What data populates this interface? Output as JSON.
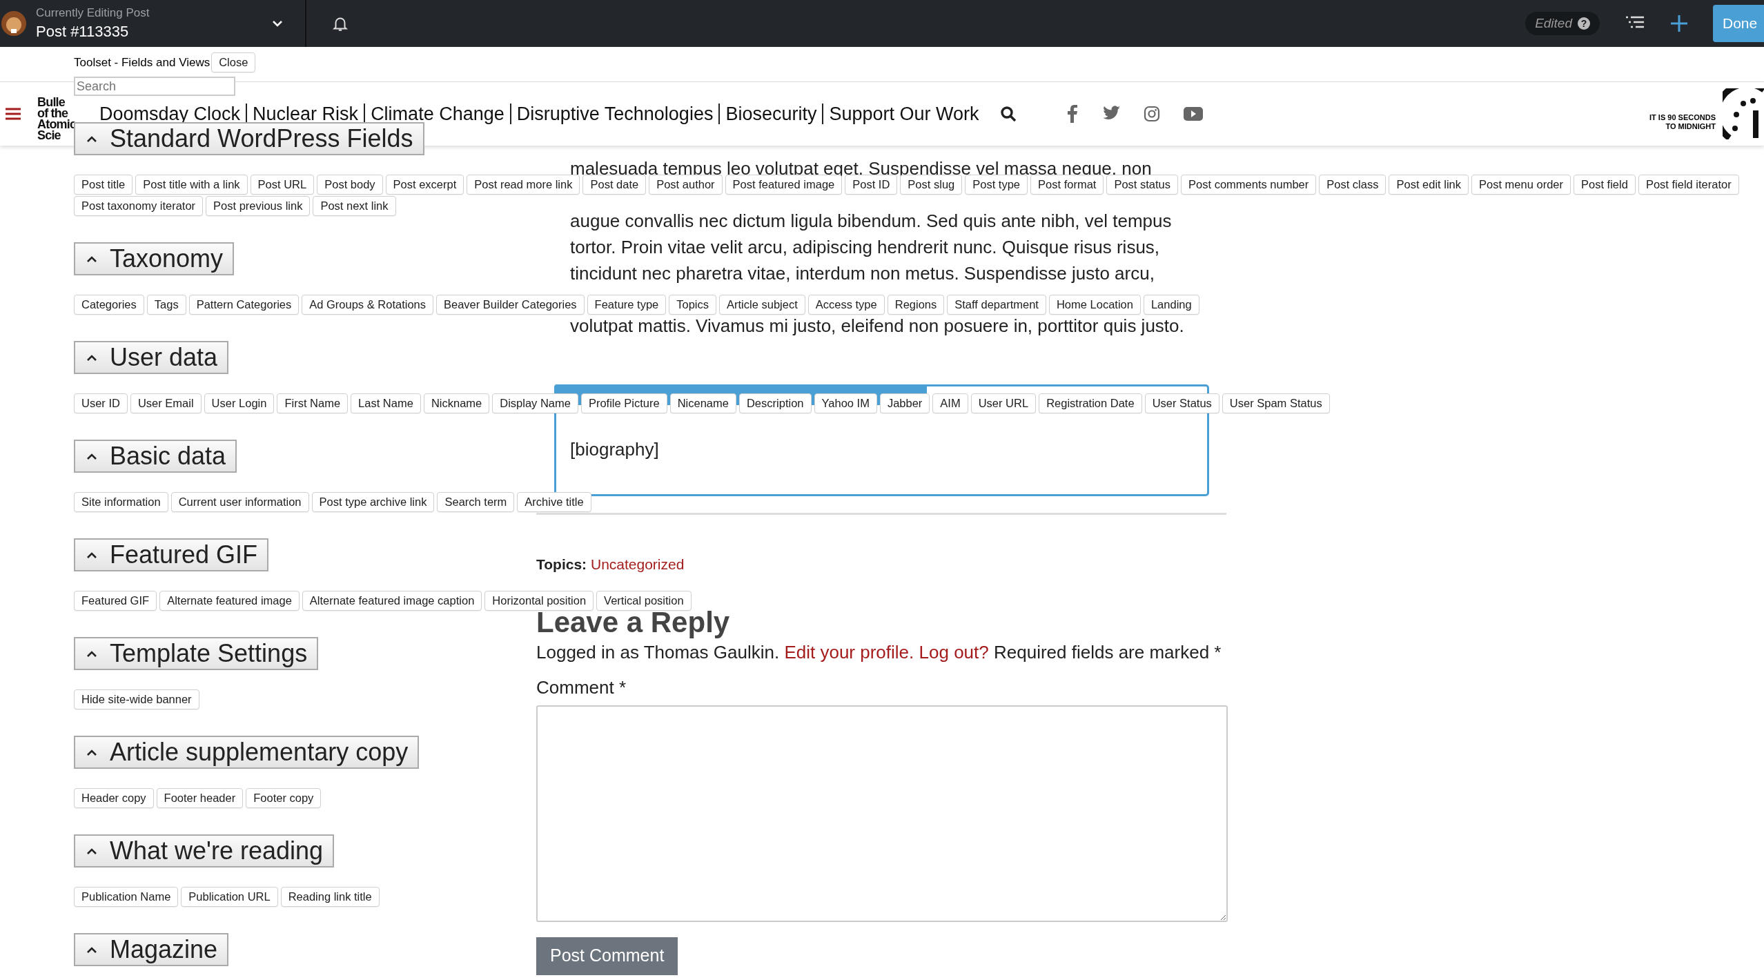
{
  "top_bar": {
    "label": "Currently Editing Post",
    "post": "Post #113335",
    "status": "Edited",
    "help": "?",
    "done": "Done"
  },
  "site_header": {
    "logo_lines": [
      "Bulle",
      "of the",
      "Atomic",
      "Scie"
    ],
    "nav": [
      "Doomsday Clock",
      "Nuclear Risk",
      "Climate Change",
      "Disruptive Technologies",
      "Biosecurity",
      "Support Our Work"
    ],
    "clock_lines": [
      "IT IS 90 SECONDS",
      "TO MIDNIGHT"
    ]
  },
  "article": {
    "paragraphs": [
      [
        "malesuada tempus leo volutpat eget. Suspendisse vel massa neque, non"
      ],
      [
        "augue convallis nec dictum ligula bibendum. Sed quis ante nibh, vel tempus",
        "tortor. Proin vitae velit arcu, adipiscing hendrerit nunc. Quisque risus risus,",
        "tincidunt nec pharetra vitae, interdum non metus. Suspendisse justo arcu,"
      ],
      [
        "volutpat mattis. Vivamus mi justo, eleifend non posuere in, porttitor quis justo."
      ]
    ],
    "editor_text": "[biography]",
    "topics_label": "Topics:",
    "topics_value": "Uncategorized",
    "reply_title": "Leave a Reply",
    "logged_in": [
      {
        "kind": "text",
        "text": "Logged in as Thomas Gaulkin."
      },
      {
        "kind": "link",
        "text": "Edit your profile."
      },
      {
        "kind": "link",
        "text": "Log out?"
      },
      {
        "kind": "text",
        "text": "Required fields are marked *"
      }
    ],
    "comment_label": "Comment *",
    "submit": "Post Comment"
  },
  "toolset": {
    "title": "Toolset - Fields and Views",
    "close": "Close",
    "search": {
      "placeholder": "Search"
    },
    "sections": [
      {
        "title": "Standard WordPress Fields",
        "expanded": true,
        "fields": [
          "Post title",
          "Post title with a link",
          "Post URL",
          "Post body",
          "Post excerpt",
          "Post read more link",
          "Post date",
          "Post author",
          "Post featured image",
          "Post ID",
          "Post slug",
          "Post type",
          "Post format",
          "Post status",
          "Post comments number",
          "Post class",
          "Post edit link",
          "Post menu order",
          "Post field",
          "Post field iterator",
          "Post taxonomy iterator",
          "Post previous link",
          "Post next link"
        ]
      },
      {
        "title": "Taxonomy",
        "expanded": true,
        "fields": [
          "Categories",
          "Tags",
          "Pattern Categories",
          "Ad Groups & Rotations",
          "Beaver Builder Categories",
          "Feature type",
          "Topics",
          "Article subject",
          "Access type",
          "Regions",
          "Staff department",
          "Home Location",
          "Landing"
        ]
      },
      {
        "title": "User data",
        "expanded": true,
        "fields": [
          "User ID",
          "User Email",
          "User Login",
          "First Name",
          "Last Name",
          "Nickname",
          "Display Name",
          "Profile Picture",
          "Nicename",
          "Description",
          "Yahoo IM",
          "Jabber",
          "AIM",
          "User URL",
          "Registration Date",
          "User Status",
          "User Spam Status"
        ]
      },
      {
        "title": "Basic data",
        "expanded": true,
        "fields": [
          "Site information",
          "Current user information",
          "Post type archive link",
          "Search term",
          "Archive title"
        ]
      },
      {
        "title": "Featured GIF",
        "expanded": true,
        "fields": [
          "Featured GIF",
          "Alternate featured image",
          "Alternate featured image caption",
          "Horizontal position",
          "Vertical position"
        ]
      },
      {
        "title": "Template Settings",
        "expanded": true,
        "fields": [
          "Hide site-wide banner"
        ]
      },
      {
        "title": "Article supplementary copy",
        "expanded": true,
        "fields": [
          "Header copy",
          "Footer header",
          "Footer copy"
        ]
      },
      {
        "title": "What we're reading",
        "expanded": true,
        "fields": [
          "Publication Name",
          "Publication URL",
          "Reading link title"
        ]
      },
      {
        "title": "Magazine",
        "expanded": true
      }
    ]
  }
}
